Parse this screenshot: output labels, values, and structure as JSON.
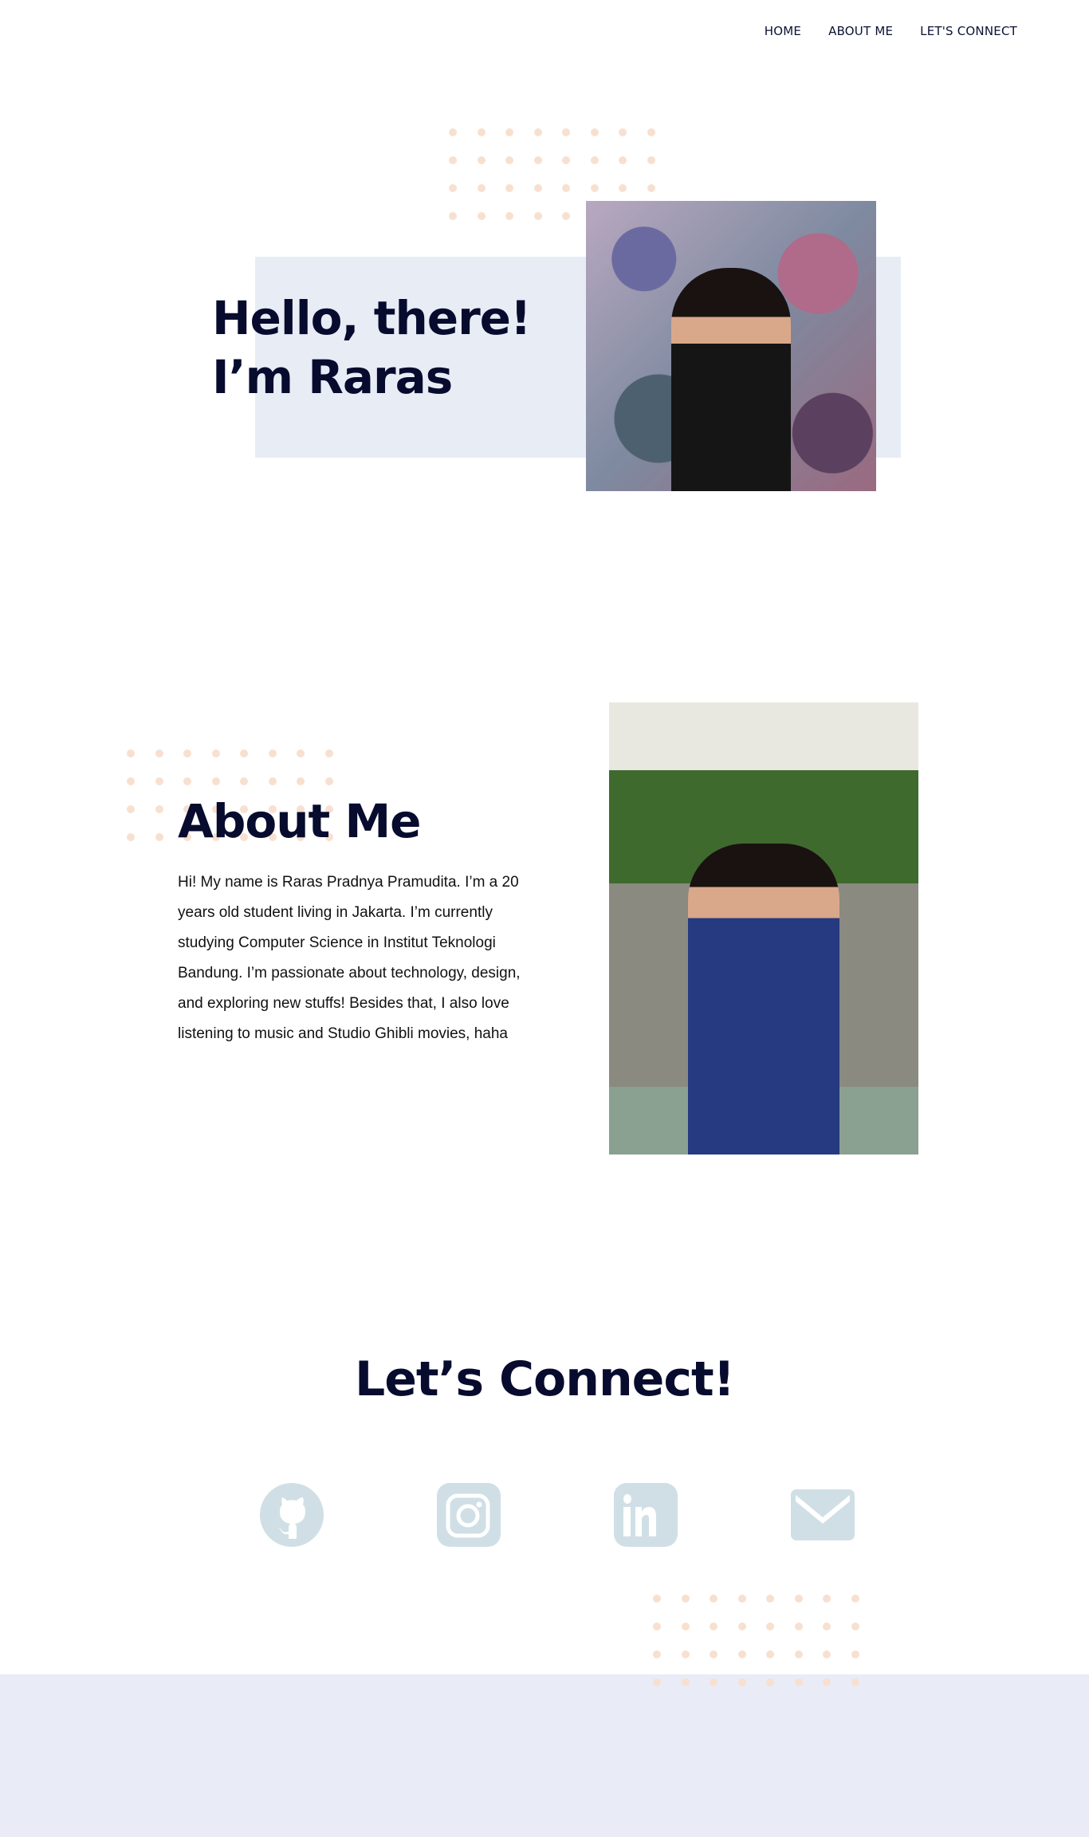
{
  "nav": {
    "items": [
      "HOME",
      "ABOUT ME",
      "LET'S CONNECT"
    ]
  },
  "hero": {
    "line1": "Hello, there!",
    "line2": "I’m Raras"
  },
  "about": {
    "title": "About Me",
    "text": "Hi! My name is Raras Pradnya Pramudita. I’m a 20 years old student living in Jakarta. I’m currently studying Computer Science in Institut Teknologi Bandung. I’m passionate about technology, design, and exploring new stuffs! Besides that, I also love listening to music and Studio Ghibli movies, haha"
  },
  "connect": {
    "title": "Let’s Connect!",
    "icons": [
      "github-icon",
      "instagram-icon",
      "linkedin-icon",
      "email-icon"
    ]
  },
  "colors": {
    "heading": "#070b2e",
    "icon": "#cfdfe5",
    "dots": "#f8e0d0",
    "band": "#e8ecf5"
  }
}
